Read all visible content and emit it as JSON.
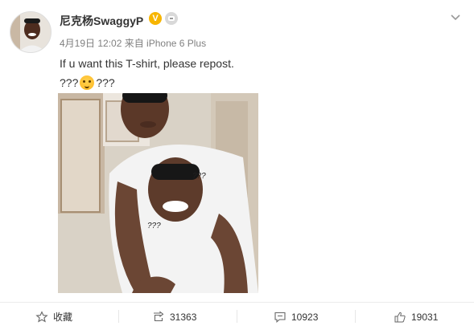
{
  "post": {
    "username": "尼克杨SwaggyP",
    "verified_badge": "V",
    "meta": "4月19日 12:02 来自 iPhone 6 Plus",
    "text": "If u want this T-shirt, please repost.",
    "emoji_line_prefix": "???",
    "emoji_line_suffix": "???",
    "photo_overlay_text_1": "???",
    "photo_overlay_text_2": "???"
  },
  "actions": {
    "favorite_label": "收藏",
    "repost_count": "31363",
    "comment_count": "10923",
    "like_count": "19031"
  },
  "colors": {
    "verified": "#f7b500",
    "meta_text": "#808080",
    "divider": "#ececec"
  },
  "icons": {
    "avatar": "user-avatar",
    "verified": "verified-v-icon",
    "robot": "robot-badge-icon",
    "menu": "chevron-down-icon",
    "favorite": "star-icon",
    "repost": "repost-icon",
    "comment": "comment-icon",
    "like": "thumbs-up-icon",
    "emoji": "cat-emoji-icon"
  }
}
